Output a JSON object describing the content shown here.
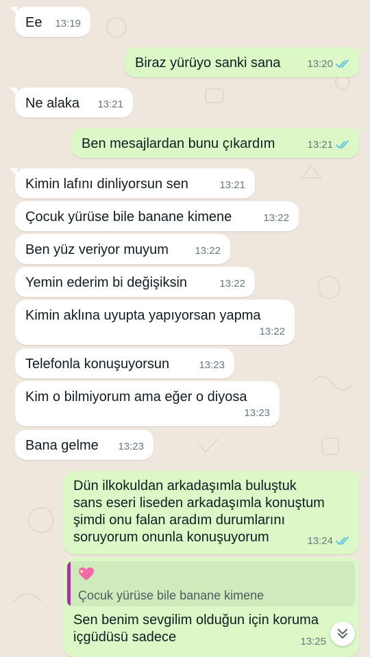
{
  "messages": [
    {
      "dir": "in",
      "text": "Ee",
      "time": "13:19"
    },
    {
      "dir": "out",
      "text": "Biraz yürüyo sanki sana",
      "time": "13:20",
      "status": "read"
    },
    {
      "dir": "in",
      "text": "Ne alaka",
      "time": "13:21"
    },
    {
      "dir": "out",
      "text": "Ben mesajlardan bunu çıkardım",
      "time": "13:21",
      "status": "read"
    },
    {
      "dir": "in",
      "text": "Kimin lafını dinliyorsun sen",
      "time": "13:21"
    },
    {
      "dir": "in",
      "text": "Çocuk yürüse bile banane kimene",
      "time": "13:22"
    },
    {
      "dir": "in",
      "text": "Ben yüz veriyor muyum",
      "time": "13:22"
    },
    {
      "dir": "in",
      "text": "Yemin ederim bi değişiksin",
      "time": "13:22"
    },
    {
      "dir": "in",
      "text": "Kimin aklına uyupta yapıyorsan yapma",
      "time": "13:22"
    },
    {
      "dir": "in",
      "text": "Telefonla konuşuyorsun",
      "time": "13:23"
    },
    {
      "dir": "in",
      "text": "Kim o bilmiyorum ama eğer o diyosa",
      "time": "13:23"
    },
    {
      "dir": "in",
      "text": "Bana gelme",
      "time": "13:23"
    },
    {
      "dir": "out",
      "text": "Dün ilkokuldan arkadaşımla buluştuk\nsans eseri liseden arkadaşımla konuştum\nşimdi onu falan aradım durumlarını\nsoruyorum onunla konuşuyorum",
      "time": "13:24",
      "status": "read"
    },
    {
      "dir": "out",
      "text": "Sen benim sevgilim olduğun için koruma\niçgüdüsü sadece",
      "time": "13:25",
      "status": "read",
      "reply": {
        "emoji": "sparkling-heart",
        "quoted_text": "Çocuk yürüse bile banane kimene"
      }
    }
  ],
  "icons": {
    "read_receipt": "double-check-icon",
    "scroll_down": "double-chevron-down-icon"
  },
  "colors": {
    "wallpaper": "#efe7de",
    "incoming": "#ffffff",
    "outgoing": "#dbf8c6",
    "read_tick": "#53bdeb",
    "reply_bar": "#a5379a"
  }
}
